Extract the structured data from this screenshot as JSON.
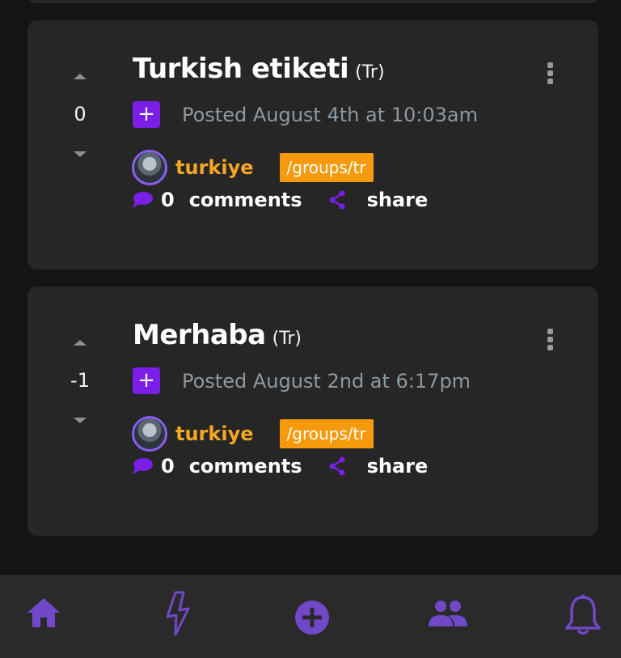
{
  "posts": [
    {
      "title": "Turkish etiketi",
      "lang": "(Tr)",
      "score": "0",
      "plus": "+",
      "posted": "Posted August 4th at 10:03am",
      "author": "turkiye",
      "group": "/groups/tr",
      "comment_count": "0",
      "comments_label": "comments",
      "share_label": "share"
    },
    {
      "title": "Merhaba",
      "lang": "(Tr)",
      "score": "-1",
      "plus": "+",
      "posted": "Posted August 2nd at 6:17pm",
      "author": "turkiye",
      "group": "/groups/tr",
      "comment_count": "0",
      "comments_label": "comments",
      "share_label": "share"
    }
  ],
  "nav": {
    "items": [
      "home-icon",
      "lightning-icon",
      "add-circle-icon",
      "groups-icon",
      "bell-icon"
    ]
  },
  "colors": {
    "accent_purple": "#7a1ee8",
    "nav_purple": "#7048c8",
    "username_orange": "#f5a623",
    "tag_orange": "#f59a0c",
    "card_bg": "#262626",
    "page_bg": "#141414"
  }
}
